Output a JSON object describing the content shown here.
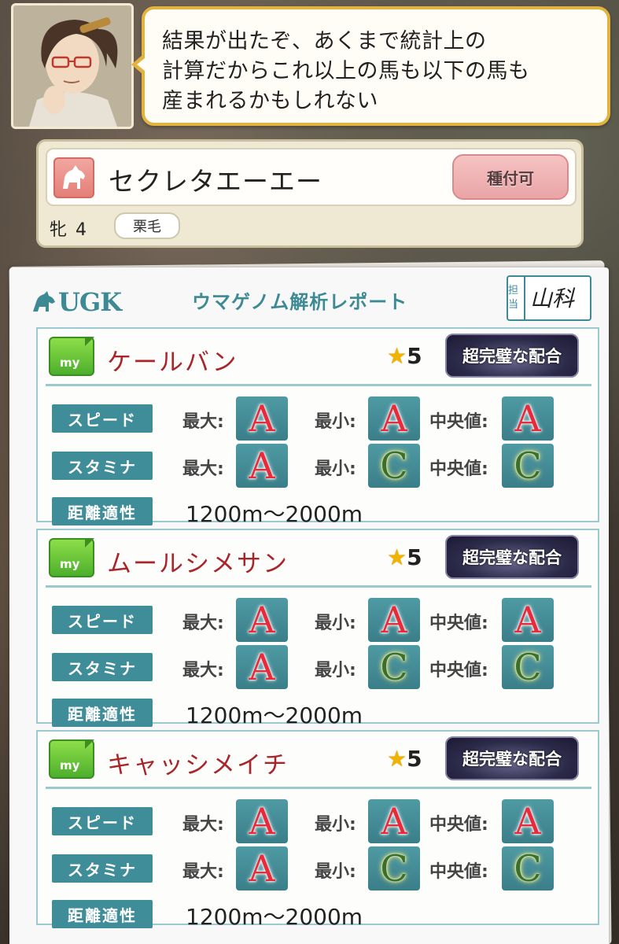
{
  "dialog": {
    "text": "結果が出たぞ、あくまで統計上の\n計算だからこれ以上の馬も以下の馬も\n産まれるかもしれない"
  },
  "horse": {
    "name": "セクレタエーエー",
    "breed_button": "種付可",
    "sex_age": "牝 4",
    "coat": "栗毛"
  },
  "report": {
    "logo": "UGK",
    "title": "ウマゲノム解析レポート",
    "stamp_label": "担当",
    "stamp_sign": "山科"
  },
  "labels": {
    "speed": "スピード",
    "stamina": "スタミナ",
    "distance": "距離適性",
    "max": "最大:",
    "min": "最小:",
    "median": "中央値:",
    "my": "my"
  },
  "sires": [
    {
      "name": "ケールバン",
      "stars": "5",
      "rating": "超完璧な配合",
      "speed": {
        "max": "A",
        "min": "A",
        "median": "A"
      },
      "stamina": {
        "max": "A",
        "min": "C",
        "median": "C"
      },
      "distance": "1200m〜2000m"
    },
    {
      "name": "ムールシメサン",
      "stars": "5",
      "rating": "超完璧な配合",
      "speed": {
        "max": "A",
        "min": "A",
        "median": "A"
      },
      "stamina": {
        "max": "A",
        "min": "C",
        "median": "C"
      },
      "distance": "1200m〜2000m"
    },
    {
      "name": "キャッシメイチ",
      "stars": "5",
      "rating": "超完璧な配合",
      "speed": {
        "max": "A",
        "min": "A",
        "median": "A"
      },
      "stamina": {
        "max": "A",
        "min": "C",
        "median": "C"
      },
      "distance": "1200m〜2000m"
    }
  ],
  "colors": {
    "accent_teal": "#3f8d98",
    "sire_name_red": "#a8262a",
    "dialog_border": "#e3b33f"
  }
}
